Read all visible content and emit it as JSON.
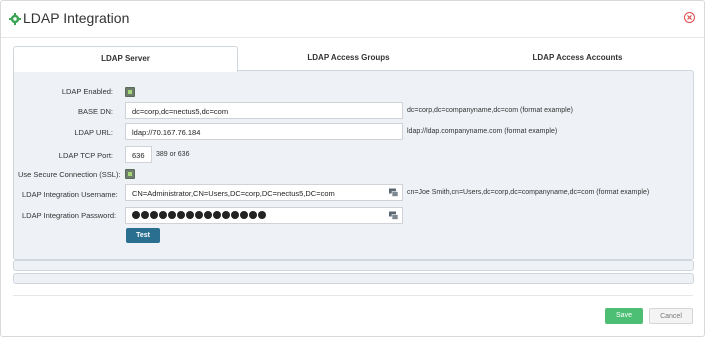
{
  "header": {
    "title": "LDAP Integration",
    "gear_icon": "gear-icon",
    "close_icon": "close-icon"
  },
  "colors": {
    "accent": "#4cbf74",
    "test_button": "#2a6f8f",
    "close": "#e04a4a",
    "panel": "#eef2f6"
  },
  "tabs": [
    {
      "label": "LDAP Server",
      "active": true
    },
    {
      "label": "LDAP Access Groups",
      "active": false
    },
    {
      "label": "LDAP Access Accounts",
      "active": false
    }
  ],
  "form": {
    "ldap_enabled": {
      "label": "LDAP Enabled:",
      "checked": true
    },
    "base_dn": {
      "label": "BASE DN:",
      "value": "dc=corp,dc=nectus5,dc=com",
      "hint": "dc=corp,dc=companyname,dc=com (format example)"
    },
    "ldap_url": {
      "label": "LDAP URL:",
      "value": "ldap://70.167.76.184",
      "hint": "ldap://ldap.companyname.com (format example)"
    },
    "tcp_port": {
      "label": "LDAP TCP Port:",
      "value": "636",
      "hint": "389 or 636"
    },
    "ssl": {
      "label": "Use Secure Connection (SSL):",
      "checked": true
    },
    "username": {
      "label": "LDAP Integration Username:",
      "value": "CN=Administrator,CN=Users,DC=corp,DC=nectus5,DC=com",
      "hint": "cn=Joe Smith,cn=Users,dc=corp,dc=companyname,dc=com (format example)",
      "icon": "keyboard-icon"
    },
    "password": {
      "label": "LDAP Integration Password:",
      "masked_length": 15,
      "icon": "keyboard-icon"
    },
    "test_label": "Test"
  },
  "footer": {
    "save_label": "Save",
    "cancel_label": "Cancel"
  }
}
